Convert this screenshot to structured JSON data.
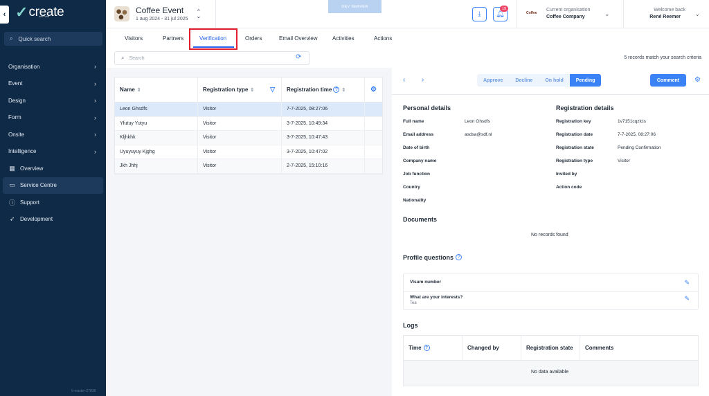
{
  "sidebar": {
    "logo_text": "create",
    "logo_sub": "with visit",
    "quick_search": "Quick search",
    "items": [
      {
        "label": "Organisation",
        "icon": "chevron-right-icon"
      },
      {
        "label": "Event",
        "icon": "chevron-right-icon"
      },
      {
        "label": "Design",
        "icon": "chevron-right-icon"
      },
      {
        "label": "Form",
        "icon": "chevron-right-icon"
      },
      {
        "label": "Onsite",
        "icon": "chevron-right-icon"
      },
      {
        "label": "Intelligence",
        "icon": "chevron-right-icon"
      },
      {
        "label": "Overview",
        "icon": "calendar-icon"
      },
      {
        "label": "Service Centre",
        "icon": "id-card-icon",
        "active": true
      },
      {
        "label": "Support",
        "icon": "info-icon"
      },
      {
        "label": "Development",
        "icon": "rocket-icon"
      }
    ],
    "version": "5-master-27838"
  },
  "header": {
    "event_title": "Coffee Event",
    "event_dates": "1 aug 2024 - 31 jul 2025",
    "dev_server": "DEV SERVER",
    "notification_count": "19",
    "org_logo_text": "Coffee",
    "org_label": "Current organisation",
    "org_name": "Coffee Company",
    "welcome": "Welcome back",
    "user_name": "René Reemer"
  },
  "tabs": [
    {
      "label": "Visitors"
    },
    {
      "label": "Partners"
    },
    {
      "label": "Verification",
      "active": true
    },
    {
      "label": "Orders"
    },
    {
      "label": "Email Overview"
    },
    {
      "label": "Activities"
    },
    {
      "label": "Actions"
    }
  ],
  "search": {
    "placeholder": "Search",
    "value": "",
    "records_text": "5 records match your search criteria"
  },
  "table": {
    "headers": {
      "name": "Name",
      "type": "Registration type",
      "time": "Registration time"
    },
    "rows": [
      {
        "name": "Leon Ghsdfs",
        "type": "Visitor",
        "time": "7-7-2025, 08:27:06",
        "selected": true
      },
      {
        "name": "Yfutuy Yutyu",
        "type": "Visitor",
        "time": "3-7-2025, 10:49:34"
      },
      {
        "name": "Kljhkhk",
        "type": "Visitor",
        "time": "3-7-2025, 10:47:43"
      },
      {
        "name": "Uyuyuyuy Kjghg",
        "type": "Visitor",
        "time": "3-7-2025, 10:47:02"
      },
      {
        "name": "Jkh Jhhj",
        "type": "Visitor",
        "time": "2-7-2025, 15:10:16"
      }
    ]
  },
  "detail": {
    "status_buttons": [
      {
        "label": "Approve"
      },
      {
        "label": "Decline"
      },
      {
        "label": "On hold"
      },
      {
        "label": "Pending",
        "active": true
      }
    ],
    "comment_label": "Comment",
    "personal": {
      "title": "Personal details",
      "fields": [
        {
          "label": "Full name",
          "value": "Leon Ghsdfs"
        },
        {
          "label": "Email address",
          "value": "asdsa@sdf.nl"
        },
        {
          "label": "Date of birth",
          "value": ""
        },
        {
          "label": "Company name",
          "value": ""
        },
        {
          "label": "Job function",
          "value": ""
        },
        {
          "label": "Country",
          "value": ""
        },
        {
          "label": "Nationality",
          "value": ""
        }
      ]
    },
    "registration": {
      "title": "Registration details",
      "fields": [
        {
          "label": "Registration key",
          "value": "1v7151cqzlcis"
        },
        {
          "label": "Registration date",
          "value": "7-7-2025, 08:27:06"
        },
        {
          "label": "Registration state",
          "value": "Pending Confirmation"
        },
        {
          "label": "Registration type",
          "value": "Visitor"
        },
        {
          "label": "Invited by",
          "value": ""
        },
        {
          "label": "Action code",
          "value": ""
        }
      ]
    },
    "documents": {
      "title": "Documents",
      "empty": "No records found"
    },
    "profile_questions": {
      "title": "Profile questions",
      "items": [
        {
          "question": "Visum number",
          "answer": ""
        },
        {
          "question": "What are your interests?",
          "answer": "Tea"
        }
      ]
    },
    "logs": {
      "title": "Logs",
      "headers": [
        "Time",
        "Changed by",
        "Registration state",
        "Comments"
      ],
      "empty": "No data available"
    }
  }
}
